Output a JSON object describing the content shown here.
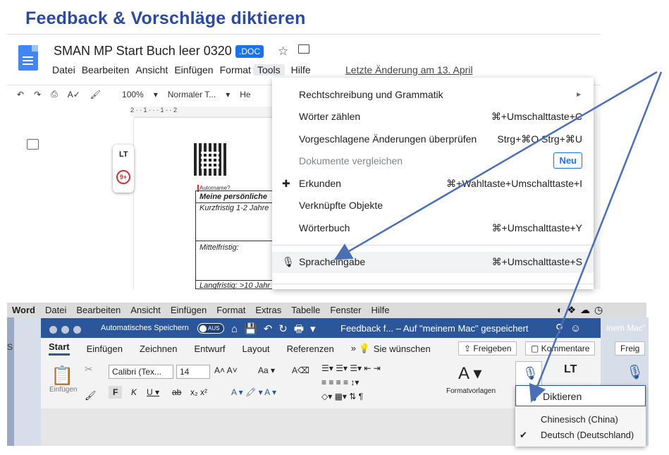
{
  "headline": "Feedback & Vorschläge diktieren",
  "gdocs": {
    "title": "SMAN MP Start Buch leer 0320",
    "badge": ".DOC",
    "menu": [
      "Datei",
      "Bearbeiten",
      "Ansicht",
      "Einfügen",
      "Format",
      "Tools",
      "Hilfe"
    ],
    "last_change": "Letzte Änderung am 13. April",
    "toolbar": {
      "zoom": "100%",
      "style": "Normaler T...",
      "font": "He"
    },
    "ruler": "2 · · 1 · · · 1 · · 2",
    "page": {
      "autorname": "Autorname?",
      "rows": [
        "Meine persönliche",
        "Kurzfristig 1-2 Jahre",
        "Mittelfristig:",
        "Langfristig: >10 Jahr"
      ]
    },
    "lt_logo": "LT",
    "lt_badge": "9+",
    "tools_menu": {
      "items": [
        {
          "label": "Rechtschreibung und Grammatik",
          "shortcut": "►"
        },
        {
          "label": "Wörter zählen",
          "shortcut": "⌘+Umschalttaste+C"
        },
        {
          "label": "Vorgeschlagene Änderungen überprüfen",
          "shortcut": "Strg+⌘O Strg+⌘U"
        },
        {
          "label": "Dokumente vergleichen",
          "badge": "Neu"
        },
        {
          "label": "Erkunden",
          "shortcut": "⌘+Wahltaste+Umschalttaste+I"
        },
        {
          "label": "Verknüpfte Objekte",
          "shortcut": ""
        },
        {
          "label": "Wörterbuch",
          "shortcut": "⌘+Umschalttaste+Y"
        },
        {
          "label": "Spracheingabe",
          "shortcut": "⌘+Umschalttaste+S"
        }
      ]
    }
  },
  "word": {
    "mac_menu": [
      "Word",
      "Datei",
      "Bearbeiten",
      "Ansicht",
      "Einfügen",
      "Format",
      "Extras",
      "Tabelle",
      "Fenster",
      "Hilfe"
    ],
    "autosave": "Automatisches Speichern",
    "autosave_state": "AUS",
    "doc_title": "Feedback f... – Auf \"meinem Mac\" gespeichert",
    "ghost_title": "inem Mac\" ge",
    "tabs": [
      "Start",
      "Einfügen",
      "Zeichnen",
      "Entwurf",
      "Layout",
      "Referenzen"
    ],
    "tell_me": "Sie wünschen",
    "share": "Freigeben",
    "comments": "Kommentare",
    "share_ghost": "Freig",
    "ribbon": {
      "paste": "Einfügen",
      "font": "Calibri (Tex...",
      "size": "14",
      "styles": "Formatvorlagen"
    },
    "dictate_menu": {
      "title": "Diktieren",
      "options": [
        "Chinesisch (China)",
        "Deutsch (Deutschland)"
      ],
      "selected": "Deutsch (Deutschland)"
    }
  },
  "colors": {
    "headline": "#2b4aa0",
    "arrow": "#4a6fb5",
    "word_blue": "#2b579a",
    "gdocs_blue": "#4285f4"
  }
}
